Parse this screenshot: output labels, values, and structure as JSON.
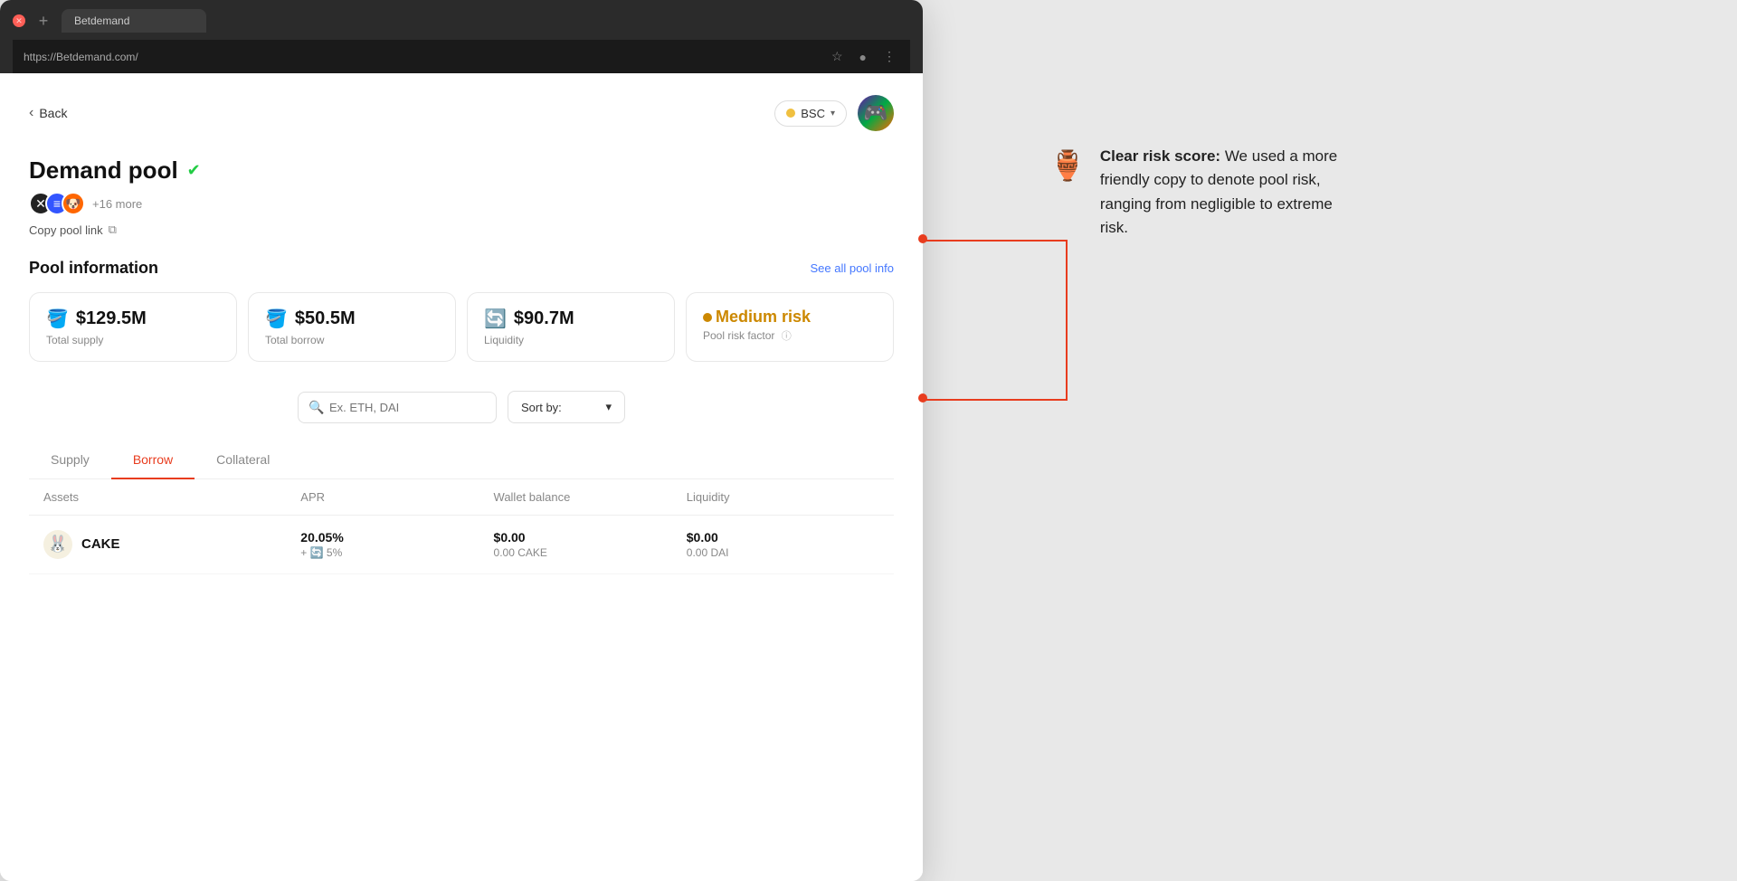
{
  "browser": {
    "url": "https://Betdemand.com/",
    "tab_title": "Betdemand"
  },
  "header": {
    "back_label": "Back",
    "network": {
      "label": "BSC",
      "dropdown_aria": "Select network"
    }
  },
  "pool": {
    "title": "Demand pool",
    "verified": true,
    "token_more": "+16 more",
    "copy_link_label": "Copy pool link"
  },
  "pool_info": {
    "section_title": "Pool information",
    "see_all_label": "See all pool info",
    "stats": [
      {
        "icon": "🪣",
        "value": "$129.5M",
        "label": "Total supply"
      },
      {
        "icon": "🪣",
        "value": "$50.5M",
        "label": "Total borrow"
      },
      {
        "icon": "🔄",
        "value": "$90.7M",
        "label": "Liquidity"
      },
      {
        "risk_dot": true,
        "value": "Medium risk",
        "label": "Pool risk factor"
      }
    ]
  },
  "search": {
    "placeholder": "Ex. ETH, DAI"
  },
  "sort": {
    "label": "Sort by:"
  },
  "tabs": [
    {
      "label": "Supply",
      "active": false
    },
    {
      "label": "Borrow",
      "active": true
    },
    {
      "label": "Collateral",
      "active": false
    }
  ],
  "table": {
    "columns": [
      "Assets",
      "APR",
      "Wallet balance",
      "Liquidity"
    ],
    "rows": [
      {
        "asset_icon": "🐰",
        "asset_name": "CAKE",
        "apr_main": "20.05%",
        "apr_sub": "+ 🔄 5%",
        "wallet_main": "$0.00",
        "wallet_sub": "0.00 CAKE",
        "liquidity_main": "$0.00",
        "liquidity_sub": "0.00 DAI"
      }
    ]
  },
  "annotation": {
    "icon": "🏺",
    "text_bold": "Clear risk score:",
    "text": " We used a more friendly copy to denote pool risk, ranging from negligible to extreme risk."
  }
}
